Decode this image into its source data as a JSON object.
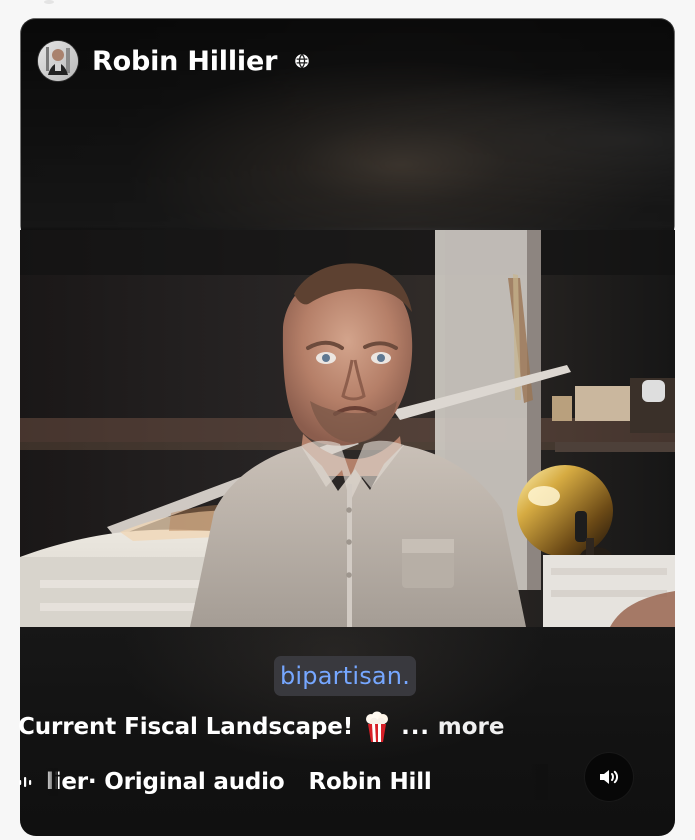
{
  "post": {
    "author_name": "Robin Hillier",
    "privacy_icon": "globe-icon",
    "caption_highlight": "bipartisan.",
    "title": "Current Fiscal Landscape!",
    "emoji": "popcorn-icon",
    "ellipsis": "...",
    "more_label": "more",
    "audio_prefix": "lier",
    "audio_middle": " · Original audio",
    "audio_suffix": "Robin Hill"
  },
  "controls": {
    "volume_icon": "volume-icon"
  },
  "colors": {
    "caption_text": "#76a7ff",
    "caption_bg": "#3a3a40",
    "background": "#121212",
    "text": "#ffffff"
  }
}
